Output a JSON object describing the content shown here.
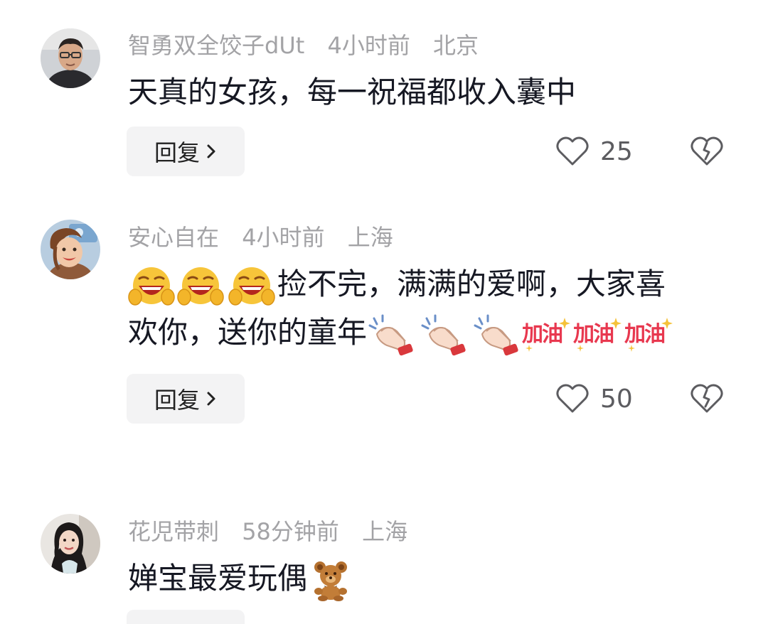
{
  "comments": [
    {
      "username": "智勇双全饺子dUt",
      "time": "4小时前",
      "location": "北京",
      "text": "天真的女孩，每一祝福都收入囊中",
      "reply_label": "回复",
      "like_count": "25"
    },
    {
      "username": "安心自在",
      "time": "4小时前",
      "location": "上海",
      "text_a": "捡不完，满满的爱啊，大家喜",
      "text_b": "欢你，送你的童年",
      "sticker_text": "加油",
      "reply_label": "回复",
      "like_count": "50"
    },
    {
      "username": "花児带刺",
      "time": "58分钟前",
      "location": "上海",
      "text": "婵宝最爱玩偶"
    }
  ],
  "icons": {
    "reply_chevron": "chevron-right-icon",
    "like": "heart-outline-icon",
    "dislike": "broken-heart-icon"
  },
  "colors": {
    "meta_text": "#a3a3a6",
    "body_text": "#161823",
    "button_bg": "#f3f3f4",
    "count_text": "#5c5c60",
    "sticker_red": "#e8384f"
  }
}
